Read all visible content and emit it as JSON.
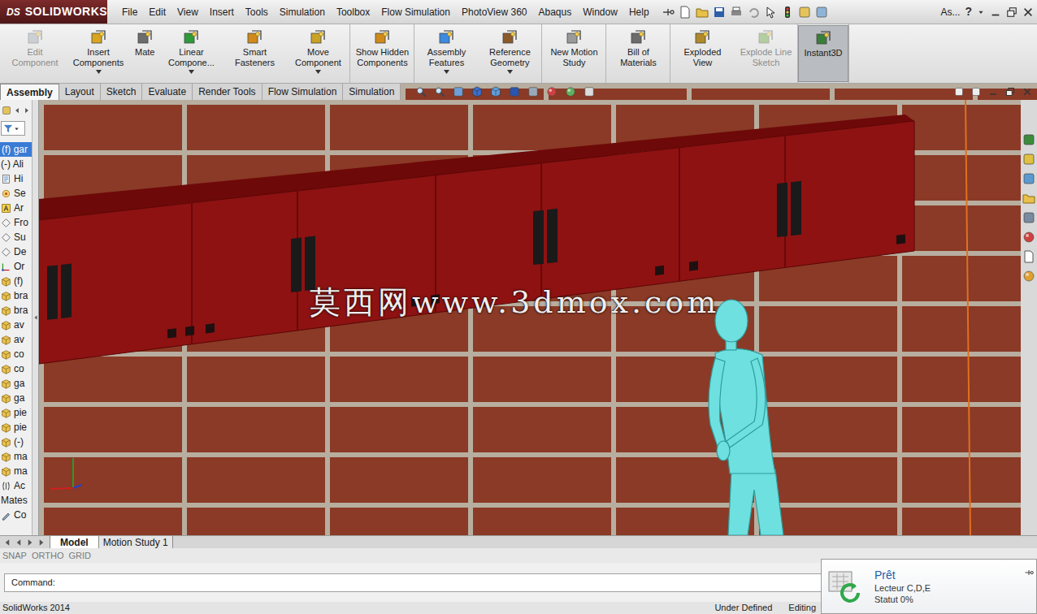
{
  "app": {
    "logo_mark": "DS",
    "logo_name": "SOLIDWORKS"
  },
  "menu": [
    "File",
    "Edit",
    "View",
    "Insert",
    "Tools",
    "Simulation",
    "Toolbox",
    "Flow Simulation",
    "PhotoView 360",
    "Abaqus",
    "Window",
    "Help"
  ],
  "title_bar": {
    "search": "As...",
    "help": "?"
  },
  "ribbon_groups": [
    [
      {
        "label": "Edit Component",
        "disabled": true,
        "dropdown": false,
        "selected": false
      },
      {
        "label": "Insert Components",
        "disabled": false,
        "dropdown": true,
        "selected": false
      },
      {
        "label": "Mate",
        "disabled": false,
        "dropdown": false,
        "selected": false
      },
      {
        "label": "Linear Compone...",
        "disabled": false,
        "dropdown": true,
        "selected": false
      },
      {
        "label": "Smart Fasteners",
        "disabled": false,
        "dropdown": false,
        "selected": false
      },
      {
        "label": "Move Component",
        "disabled": false,
        "dropdown": true,
        "selected": false
      }
    ],
    [
      {
        "label": "Show Hidden Components",
        "disabled": false,
        "dropdown": false,
        "selected": false
      }
    ],
    [
      {
        "label": "Assembly Features",
        "disabled": false,
        "dropdown": true,
        "selected": false
      },
      {
        "label": "Reference Geometry",
        "disabled": false,
        "dropdown": true,
        "selected": false
      }
    ],
    [
      {
        "label": "New Motion Study",
        "disabled": false,
        "dropdown": false,
        "selected": false
      }
    ],
    [
      {
        "label": "Bill of Materials",
        "disabled": false,
        "dropdown": false,
        "selected": false
      }
    ],
    [
      {
        "label": "Exploded View",
        "disabled": false,
        "dropdown": false,
        "selected": false
      },
      {
        "label": "Explode Line Sketch",
        "disabled": true,
        "dropdown": false,
        "selected": false
      }
    ],
    [
      {
        "label": "Instant3D",
        "disabled": false,
        "dropdown": false,
        "selected": true
      }
    ]
  ],
  "command_tabs": [
    {
      "label": "Assembly",
      "selected": true
    },
    {
      "label": "Layout",
      "selected": false
    },
    {
      "label": "Sketch",
      "selected": false
    },
    {
      "label": "Evaluate",
      "selected": false
    },
    {
      "label": "Render Tools",
      "selected": false
    },
    {
      "label": "Flow Simulation",
      "selected": false
    },
    {
      "label": "Simulation",
      "selected": false
    }
  ],
  "feature_tree": [
    {
      "text": "(f) gar",
      "kind": "none",
      "selected": true
    },
    {
      "text": "(-) Ali",
      "kind": "none",
      "selected": false
    },
    {
      "text": "Hi",
      "kind": "history",
      "selected": false
    },
    {
      "text": "Se",
      "kind": "sensor",
      "selected": false
    },
    {
      "text": "Ar",
      "kind": "annotation",
      "selected": false
    },
    {
      "text": "Fro",
      "kind": "plane",
      "selected": false
    },
    {
      "text": "Su",
      "kind": "plane",
      "selected": false
    },
    {
      "text": "De",
      "kind": "plane",
      "selected": false
    },
    {
      "text": "Or",
      "kind": "origin",
      "selected": false
    },
    {
      "text": "(f)",
      "kind": "part",
      "selected": false
    },
    {
      "text": "bra",
      "kind": "part",
      "selected": false
    },
    {
      "text": "bra",
      "kind": "part",
      "selected": false
    },
    {
      "text": "av",
      "kind": "part",
      "selected": false
    },
    {
      "text": "av",
      "kind": "part",
      "selected": false
    },
    {
      "text": "co",
      "kind": "part",
      "selected": false
    },
    {
      "text": "co",
      "kind": "part",
      "selected": false
    },
    {
      "text": "ga",
      "kind": "part",
      "selected": false
    },
    {
      "text": "ga",
      "kind": "part",
      "selected": false
    },
    {
      "text": "pie",
      "kind": "part",
      "selected": false
    },
    {
      "text": "pie",
      "kind": "part",
      "selected": false
    },
    {
      "text": "(-)",
      "kind": "part",
      "selected": false
    },
    {
      "text": "ma",
      "kind": "part",
      "selected": false
    },
    {
      "text": "ma",
      "kind": "part",
      "selected": false
    },
    {
      "text": "Ac",
      "kind": "pattern",
      "selected": false
    },
    {
      "text": "Mates",
      "kind": "none",
      "selected": false
    },
    {
      "text": "Co",
      "kind": "mate",
      "selected": false
    }
  ],
  "viewport": {
    "watermark": "莫西网www.3dmox.com"
  },
  "model_tabs": [
    {
      "label": "Model",
      "selected": true
    },
    {
      "label": "Motion Study 1",
      "selected": false
    }
  ],
  "toggles": [
    "SNAP",
    "ORTHO",
    "GRID"
  ],
  "command_line": {
    "label": "Command:",
    "value": ""
  },
  "status_bar": [
    "SolidWorks 2014",
    "Under Defined",
    "Editing"
  ],
  "notification": {
    "title": "Prêt",
    "lines": [
      "Lecteur C,D,E",
      "Statut 0%"
    ]
  }
}
